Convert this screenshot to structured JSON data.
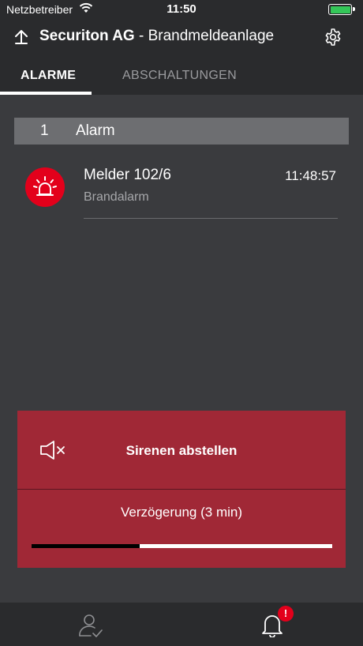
{
  "status_bar": {
    "carrier": "Netzbetreiber",
    "time": "11:50"
  },
  "header": {
    "company": "Securiton AG",
    "separator": " - ",
    "system": "Brandmeldeanlage"
  },
  "tabs": [
    {
      "label": "ALARME",
      "active": true
    },
    {
      "label": "ABSCHALTUNGEN",
      "active": false
    }
  ],
  "alarm_group": {
    "count": "1",
    "label": "Alarm"
  },
  "alarms": [
    {
      "title": "Melder 102/6",
      "subtitle": "Brandalarm",
      "time": "11:48:57",
      "icon": "alarm-light-icon"
    }
  ],
  "actions": {
    "silence_label": "Sirenen abstellen",
    "delay_label": "Verzögerung (3 min)",
    "delay_progress": 0.36
  },
  "bottom_bar": {
    "badge": "!"
  },
  "colors": {
    "alarm_red": "#e3001b",
    "action_red": "#a02836",
    "background": "#3a3b3e",
    "bar": "#2a2b2d",
    "battery": "#34c759"
  }
}
